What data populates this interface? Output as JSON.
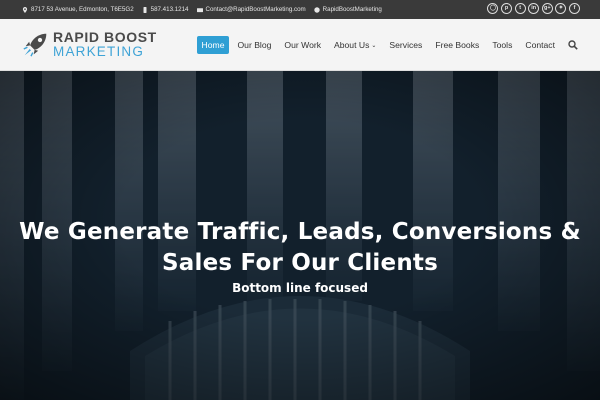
{
  "topbar": {
    "address": "8717 53 Avenue, Edmonton, T6E5G2",
    "phone": "587.413.1214",
    "email": "Contact@RapidBoostMarketing.com",
    "skype": "RapidBoostMarketing",
    "social": [
      "instagram-icon",
      "pinterest-icon",
      "tumblr-icon",
      "linkedin-icon",
      "google-plus-icon",
      "twitter-icon",
      "facebook-icon"
    ]
  },
  "logo": {
    "line1": "RAPID BOOST",
    "line2": "MARKETING"
  },
  "nav": {
    "items": [
      "Home",
      "Our Blog",
      "Our Work",
      "About Us",
      "Services",
      "Free Books",
      "Tools",
      "Contact"
    ],
    "active": "Home"
  },
  "hero": {
    "title_line1": "We Generate Traffic, Leads, Conversions &",
    "title_line2": "Sales For Our Clients",
    "subtitle": "Bottom line focused"
  },
  "colors": {
    "accent": "#2f9fd4",
    "topbar": "#3a3a3a",
    "hero": "#132330"
  }
}
